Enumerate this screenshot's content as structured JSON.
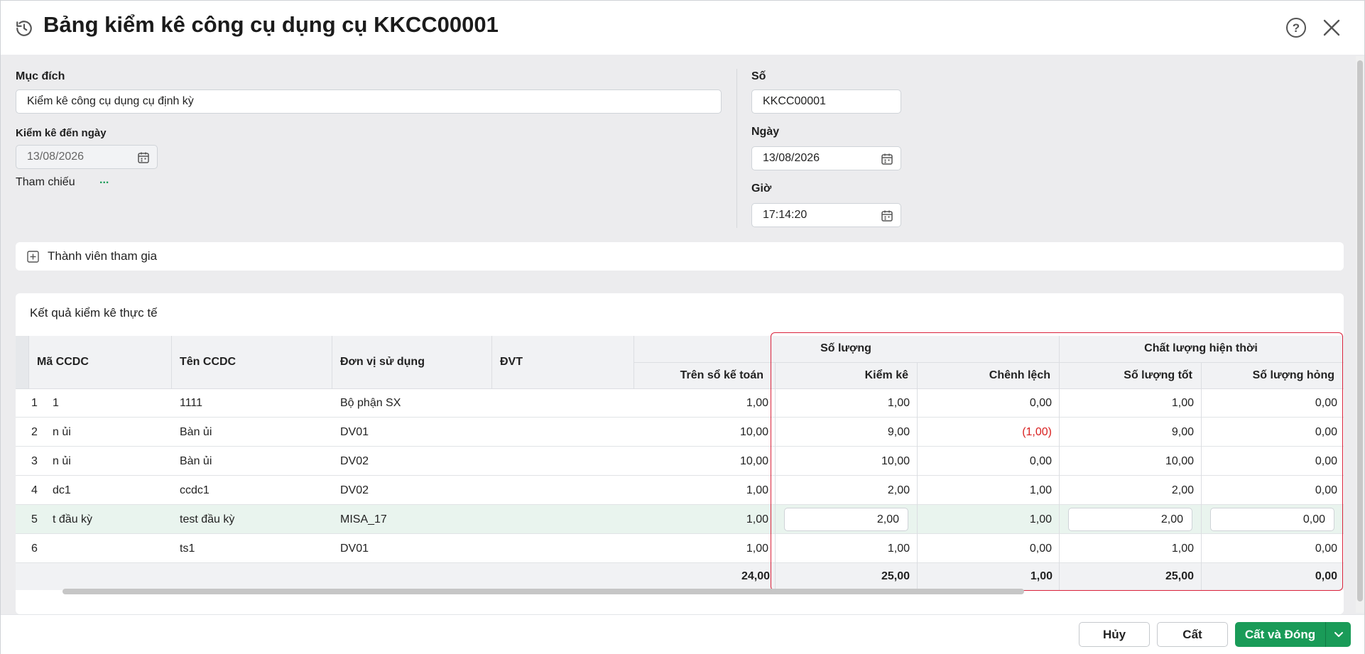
{
  "window": {
    "title": "Bảng kiểm kê công cụ dụng cụ KKCC00001",
    "icons": {
      "history": "history-icon",
      "help": "help-icon",
      "close": "close-icon"
    }
  },
  "form": {
    "purpose_label": "Mục đích",
    "purpose_value": "Kiểm kê công cụ dụng cụ định kỳ",
    "inventory_date_label": "Kiểm kê đến ngày",
    "inventory_date_value": "13/08/2026",
    "reference_label": "Tham chiếu",
    "reference_action": "...",
    "number_label": "Số",
    "number_value": "KKCC00001",
    "date_label": "Ngày",
    "date_value": "13/08/2026",
    "time_label": "Giờ",
    "time_value": "17:14:20"
  },
  "members": {
    "label": "Thành viên tham gia"
  },
  "results": {
    "title": "Kết quả kiểm kê thực tế",
    "headers": {
      "code": "Mã CCDC",
      "name": "Tên CCDC",
      "unit_dept": "Đơn vị sử dụng",
      "uom": "ĐVT",
      "group_quantity": "Số lượng",
      "group_quality": "Chất lượng hiện thời",
      "book": "Trên sổ kế toán",
      "counted": "Kiểm kê",
      "diff": "Chênh lệch",
      "good": "Số lượng tốt",
      "broken": "Số lượng hỏng"
    },
    "rows": [
      {
        "no": "1",
        "code": "1",
        "name": "1111",
        "dept": "Bộ phận SX",
        "uom": "",
        "book": "1,00",
        "counted": "1,00",
        "diff": "0,00",
        "good": "1,00",
        "broken": "0,00"
      },
      {
        "no": "2",
        "code": "n ủi",
        "name": "Bàn ủi",
        "dept": "DV01",
        "uom": "",
        "book": "10,00",
        "counted": "9,00",
        "diff": "(1,00)",
        "good": "9,00",
        "broken": "0,00"
      },
      {
        "no": "3",
        "code": "n ủi",
        "name": "Bàn ủi",
        "dept": "DV02",
        "uom": "",
        "book": "10,00",
        "counted": "10,00",
        "diff": "0,00",
        "good": "10,00",
        "broken": "0,00"
      },
      {
        "no": "4",
        "code": "dc1",
        "name": "ccdc1",
        "dept": "DV02",
        "uom": "",
        "book": "1,00",
        "counted": "2,00",
        "diff": "1,00",
        "good": "2,00",
        "broken": "0,00"
      },
      {
        "no": "5",
        "code": "t đầu kỳ",
        "name": "test đầu kỳ",
        "dept": "MISA_17",
        "uom": "",
        "book": "1,00",
        "counted": "2,00",
        "diff": "1,00",
        "good": "2,00",
        "broken": "0,00"
      },
      {
        "no": "6",
        "code": "",
        "name": "ts1",
        "dept": "DV01",
        "uom": "",
        "book": "1,00",
        "counted": "1,00",
        "diff": "0,00",
        "good": "1,00",
        "broken": "0,00"
      }
    ],
    "totals": {
      "book": "24,00",
      "counted": "25,00",
      "diff": "1,00",
      "good": "25,00",
      "broken": "0,00"
    }
  },
  "buttons": {
    "cancel": "Hủy",
    "save": "Cất",
    "save_close": "Cất và Đóng"
  },
  "colors": {
    "accent": "#1a9b58",
    "negative": "#d92020",
    "highlight": "#d9213a"
  }
}
